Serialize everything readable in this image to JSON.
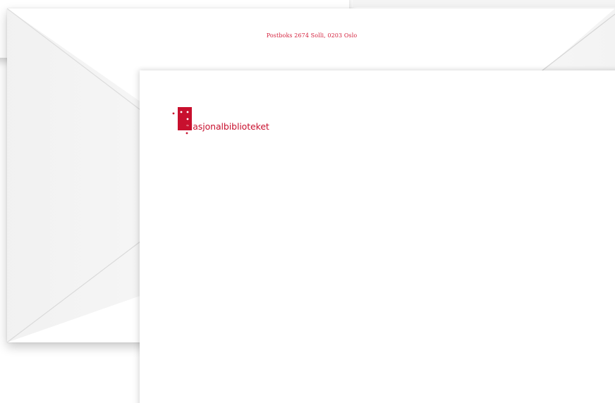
{
  "envelope": {
    "return_address": "Postboks 2674 Solli, 0203 Oslo"
  },
  "letterhead": {
    "logo_text": "Nasjonalbiblioteket"
  },
  "colors": {
    "brand_red": "#c8102e",
    "address_red": "#d4213d",
    "paper": "#ffffff"
  }
}
